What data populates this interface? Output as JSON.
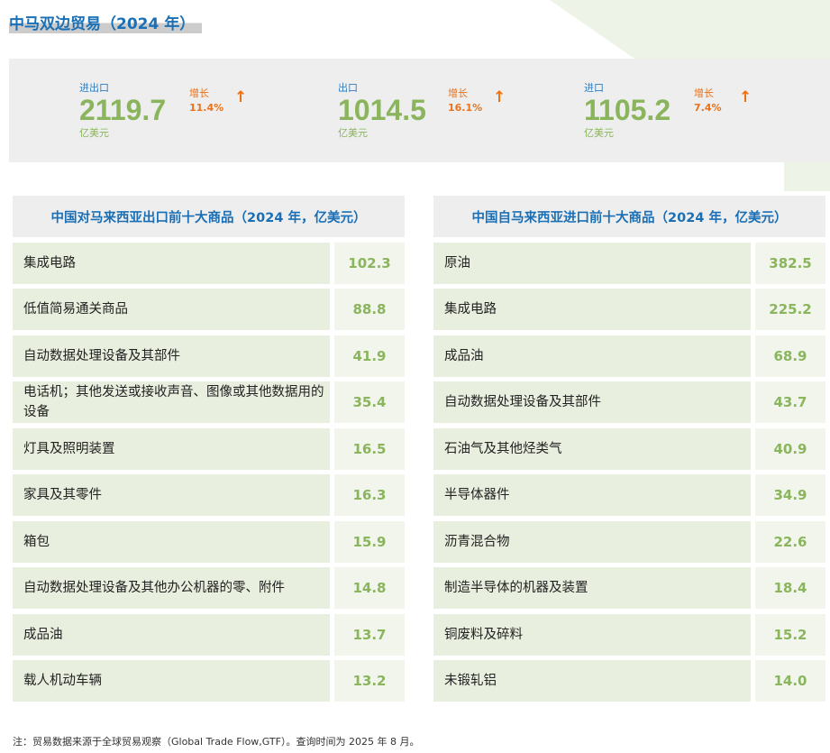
{
  "title": "中马双边贸易（2024 年）",
  "stats": [
    {
      "label": "进出口",
      "value": "2119.7",
      "unit": "亿美元",
      "growth_label": "增长",
      "growth": "11.4%"
    },
    {
      "label": "出口",
      "value": "1014.5",
      "unit": "亿美元",
      "growth_label": "增长",
      "growth": "16.1%"
    },
    {
      "label": "进口",
      "value": "1105.2",
      "unit": "亿美元",
      "growth_label": "增长",
      "growth": "7.4%"
    }
  ],
  "export_table": {
    "title": "中国对马来西亚出口前十大商品（2024 年，亿美元）",
    "rows": [
      {
        "name": "集成电路",
        "value": "102.3"
      },
      {
        "name": "低值简易通关商品",
        "value": "88.8"
      },
      {
        "name": "自动数据处理设备及其部件",
        "value": "41.9"
      },
      {
        "name": "电话机；其他发送或接收声音、图像或其他数据用的设备",
        "value": "35.4"
      },
      {
        "name": "灯具及照明装置",
        "value": "16.5"
      },
      {
        "name": "家具及其零件",
        "value": "16.3"
      },
      {
        "name": "箱包",
        "value": "15.9"
      },
      {
        "name": "自动数据处理设备及其他办公机器的零、附件",
        "value": "14.8"
      },
      {
        "name": "成品油",
        "value": "13.7"
      },
      {
        "name": "载人机动车辆",
        "value": "13.2"
      }
    ]
  },
  "import_table": {
    "title": "中国自马来西亚进口前十大商品（2024 年，亿美元）",
    "rows": [
      {
        "name": "原油",
        "value": "382.5"
      },
      {
        "name": "集成电路",
        "value": "225.2"
      },
      {
        "name": "成品油",
        "value": "68.9"
      },
      {
        "name": "自动数据处理设备及其部件",
        "value": "43.7"
      },
      {
        "name": "石油气及其他烃类气",
        "value": "40.9"
      },
      {
        "name": "半导体器件",
        "value": "34.9"
      },
      {
        "name": "沥青混合物",
        "value": "22.6"
      },
      {
        "name": "制造半导体的机器及装置",
        "value": "18.4"
      },
      {
        "name": "铜废料及碎料",
        "value": "15.2"
      },
      {
        "name": "未锻轧铝",
        "value": "14.0"
      }
    ]
  },
  "note": "注：贸易数据来源于全球贸易观察（Global Trade Flow,GTF）。查询时间为 2025 年 8 月。"
}
